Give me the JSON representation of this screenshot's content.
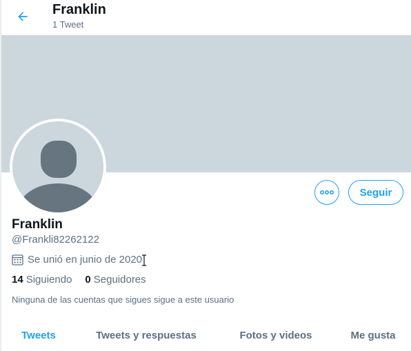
{
  "colors": {
    "accent": "#1da1f2",
    "banner": "#ccd6dd",
    "avatar_silhouette": "#66757f",
    "secondary_text": "#5b7083",
    "primary_text": "#0f1419"
  },
  "header": {
    "back_icon": "arrow-left-icon",
    "title": "Franklin",
    "subtitle": "1 Tweet"
  },
  "profile": {
    "avatar_icon": "default-avatar-silhouette",
    "name": "Franklin",
    "handle": "@Frankli82262122",
    "joined_icon": "calendar-icon",
    "joined": "Se unió en junio de 2020",
    "following_count": "14",
    "following_label": "Siguiendo",
    "followers_count": "0",
    "followers_label": "Seguidores",
    "mutual_note": "Ninguna de las cuentas que sigues sigue a este usuario"
  },
  "actions": {
    "more_icon": "more-horizontal-icon",
    "follow_label": "Seguir"
  },
  "tabs": [
    {
      "label": "Tweets",
      "active": true
    },
    {
      "label": "Tweets y respuestas",
      "active": false
    },
    {
      "label": "Fotos y videos",
      "active": false
    },
    {
      "label": "Me gusta",
      "active": false
    }
  ]
}
